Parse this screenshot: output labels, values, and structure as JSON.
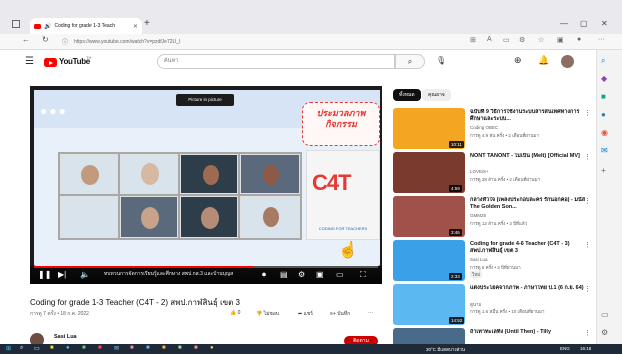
{
  "browser": {
    "tab_title": "Coding for grade 1-3 Teach",
    "tab_close": "✕",
    "new_tab": "+",
    "url": "https://www.youtube.com/watch?v=pzdfJe72U_I",
    "window_controls": [
      "—",
      "▢",
      "✕"
    ]
  },
  "youtube": {
    "logo_word": "YouTube",
    "logo_country": "TH",
    "search_placeholder": "ค้นหา"
  },
  "player": {
    "pip_label": "Picture in picture",
    "banner_text": "ประมวลภาพกิจกรรม",
    "c4t_logo": "C4T",
    "c4t_sub": "CODING FOR TEACHERS",
    "chapter_text": "ทบทวนการจัดการเรียนรู้และศึกษาง สพป.กส.3 และบ้านบุญส",
    "progress": 0.64
  },
  "video": {
    "title": "Coding for grade 1-3 Teacher (C4T - 2) สพป.กาฬสินธุ์ เขต 3",
    "meta": "การดู 7 ครั้ง • 18 ก.ค. 2022",
    "likes": "0",
    "dislike_label": "ไม่ชอบ",
    "share_label": "แชร์",
    "save_label": "บันทึก",
    "more_label": "···",
    "channel": "Sasi Lua",
    "subscribe_label": "ติดตาม"
  },
  "related": {
    "chips": [
      "ทั้งหมด",
      "คุณอาจ"
    ],
    "items": [
      {
        "title": "ฉบับที่ 9 วิธีการใช้งานระบบสารสนเทศทางการศึกษาและระบบ...",
        "channel": "Coding OBEC",
        "meta": "การดู 4.9 พัน ครั้ง • 2 เดือนที่ผ่านมา",
        "duration": "10:11",
        "color": "#f4a623"
      },
      {
        "title": "NONT TANONT - ไม่เป็น (Melt) [Official MV]",
        "channel": "LOVEiS+",
        "meta": "การดู 28 ล้าน ครั้ง • 2 เดือนที่ผ่านมา",
        "duration": "4:59",
        "color": "#7a3b2e"
      },
      {
        "title": "กลางหัวใจ (เพลงประกอบละคร รักนอกคอ) - มนัส The Golden Son...",
        "channel": "GMM25",
        "meta": "การดู 12 ล้าน ครั้ง • 3 ปีที่แล้ว",
        "duration": "3:46",
        "color": "#a0524a"
      },
      {
        "title": "Coding for grade 4-6 Teacher (C4T - 3) สพป.กาฬสินธุ์ เขต 3",
        "channel": "Sasi Lua",
        "meta": "การดู 6 ครั้ง • 3 ปีที่ผ่านมา",
        "duration": "2:33",
        "badge": "ใหม่",
        "color": "#3aa0e8"
      },
      {
        "title": "แต่งประโยคจากภาพ - ภาษาไทย ป.1 (6 ก.ย. 64)",
        "channel": "ดูนาม",
        "meta": "การดู 1.6 หมื่น ครั้ง • 10 เดือนที่ผ่านมา",
        "duration": "14:52",
        "color": "#5bb8f0"
      },
      {
        "title": "ถ้าเทาทะเลทิ้ง (Until Then) - Tilly",
        "channel": "",
        "meta": "",
        "duration": "",
        "color": "#4a6a8a"
      }
    ]
  },
  "taskbar": {
    "weather": "30°C  มีแดดบางส่วน",
    "lang": "ENG",
    "time": "16:18"
  },
  "colors": {
    "brand": "#ff0000",
    "subscribe": "#cc0000",
    "banner": "#e53935"
  }
}
